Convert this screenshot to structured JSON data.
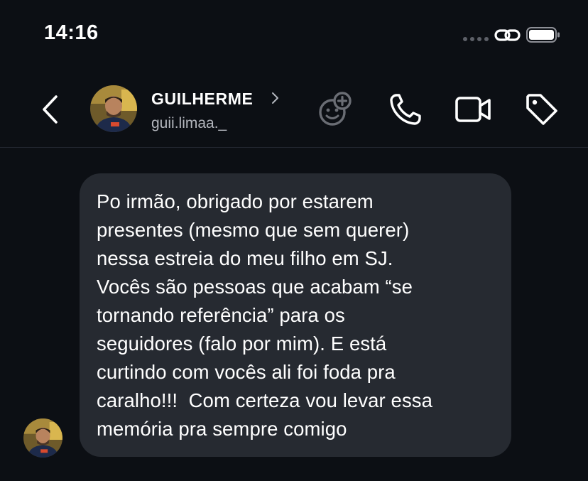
{
  "status_bar": {
    "time": "14:16",
    "icons": [
      "signal-dots-icon",
      "link-icon",
      "battery-icon"
    ]
  },
  "header": {
    "name": "GUILHERME",
    "username": "guii.limaa._",
    "icons": [
      "back-chevron-icon",
      "avatar",
      "chevron-right-icon",
      "effects-icon",
      "phone-icon",
      "video-camera-icon",
      "tag-icon"
    ]
  },
  "message": {
    "text": "Po irmão, obrigado por estarem\npresentes (mesmo que sem querer)\nnessa estreia do meu filho em SJ.\nVocês são pessoas que acabam “se\ntornando referência” para os\nseguidores (falo por mim). E está\ncurtindo com vocês ali foi foda pra\ncaralho!!!  Com certeza vou levar essa\nmemória pra sempre comigo"
  },
  "colors": {
    "background": "#0c0f14",
    "bubble": "#262a31",
    "text": "#ffffff",
    "secondary_text": "#b3b6bd",
    "muted_icon": "#5d6068"
  }
}
